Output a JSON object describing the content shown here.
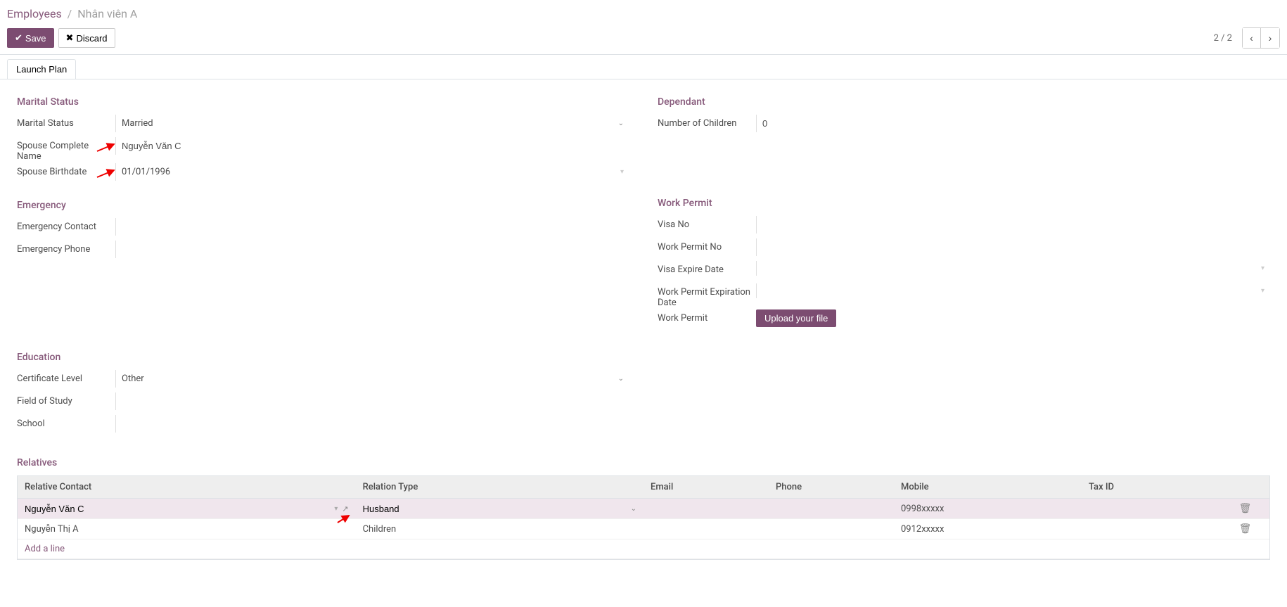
{
  "breadcrumb": {
    "root": "Employees",
    "current": "Nhân viên A"
  },
  "toolbar": {
    "save": "Save",
    "discard": "Discard",
    "pager": "2 / 2"
  },
  "statusbar": {
    "launch_plan": "Launch Plan"
  },
  "sections": {
    "marital_title": "Marital Status",
    "marital_status_label": "Marital Status",
    "marital_status_value": "Married",
    "spouse_name_label": "Spouse Complete Name",
    "spouse_name_value": "Nguyễn Văn C",
    "spouse_birthdate_label": "Spouse Birthdate",
    "spouse_birthdate_value": "01/01/1996",
    "emergency_title": "Emergency",
    "emergency_contact_label": "Emergency Contact",
    "emergency_phone_label": "Emergency Phone",
    "dependant_title": "Dependant",
    "num_children_label": "Number of Children",
    "num_children_value": "0",
    "work_permit_title": "Work Permit",
    "visa_no_label": "Visa No",
    "work_permit_no_label": "Work Permit No",
    "visa_expire_label": "Visa Expire Date",
    "work_permit_exp_label": "Work Permit Expiration Date",
    "work_permit_label": "Work Permit",
    "upload_file": "Upload your file",
    "education_title": "Education",
    "cert_level_label": "Certificate Level",
    "cert_level_value": "Other",
    "field_study_label": "Field of Study",
    "school_label": "School",
    "relatives_title": "Relatives"
  },
  "relatives_table": {
    "columns": {
      "contact": "Relative Contact",
      "relation": "Relation Type",
      "email": "Email",
      "phone": "Phone",
      "mobile": "Mobile",
      "tax": "Tax ID"
    },
    "rows": [
      {
        "contact": "Nguyễn Văn C",
        "relation": "Husband",
        "email": "",
        "phone": "",
        "mobile": "0998xxxxx",
        "tax": "",
        "selected": true,
        "editable": true
      },
      {
        "contact": "Nguyễn Thị A",
        "relation": "Children",
        "email": "",
        "phone": "",
        "mobile": "0912xxxxx",
        "tax": "",
        "selected": false,
        "editable": false
      }
    ],
    "add_line": "Add a line"
  }
}
